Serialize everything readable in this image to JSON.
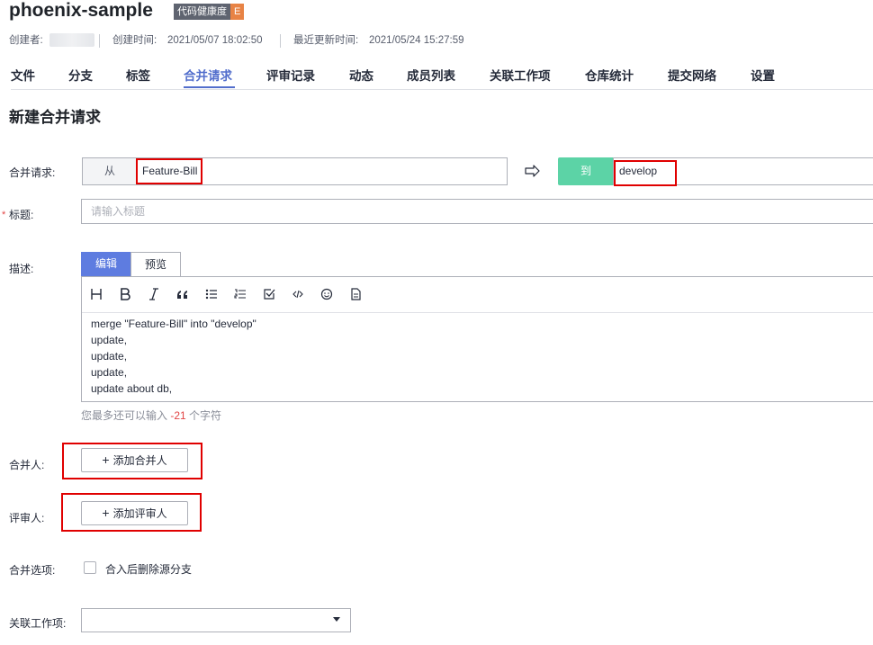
{
  "repo": {
    "name": "phoenix-sample",
    "health_label": "代码健康度",
    "health_grade": "E"
  },
  "meta": {
    "creator_label": "创建者:",
    "created_label": "创建时间:",
    "created_value": "2021/05/07 18:02:50",
    "updated_label": "最近更新时间:",
    "updated_value": "2021/05/24 15:27:59"
  },
  "tabs": [
    {
      "label": "文件"
    },
    {
      "label": "分支"
    },
    {
      "label": "标签"
    },
    {
      "label": "合并请求",
      "active": true
    },
    {
      "label": "评审记录"
    },
    {
      "label": "动态"
    },
    {
      "label": "成员列表"
    },
    {
      "label": "关联工作项"
    },
    {
      "label": "仓库统计"
    },
    {
      "label": "提交网络"
    },
    {
      "label": "设置"
    }
  ],
  "page_title": "新建合并请求",
  "form": {
    "merge_label": "合并请求:",
    "from_label": "从",
    "from_branch": "Feature-Bill",
    "to_label": "到",
    "to_branch": "develop",
    "title_required": "*",
    "title_label": "标题:",
    "title_placeholder": "请输入标题",
    "desc_label": "描述:",
    "edit_tab": "编辑",
    "preview_tab": "预览",
    "description_lines": [
      "merge \"Feature-Bill\" into \"develop\"",
      "update,",
      "update,",
      "update,",
      "update about db,"
    ],
    "hint_prefix": "您最多还可以输入",
    "hint_count": "-21",
    "hint_suffix": "个字符",
    "merger_label": "合并人:",
    "add_merger": "添加合并人",
    "reviewer_label": "评审人:",
    "add_reviewer": "添加评审人",
    "options_label": "合并选项:",
    "delete_branch_option": "合入后删除源分支",
    "work_item_label": "关联工作项:"
  },
  "colors": {
    "accent": "#526ecc",
    "to_tag": "#5cd3a6",
    "highlight": "#e00000",
    "grade": "#e88345"
  }
}
